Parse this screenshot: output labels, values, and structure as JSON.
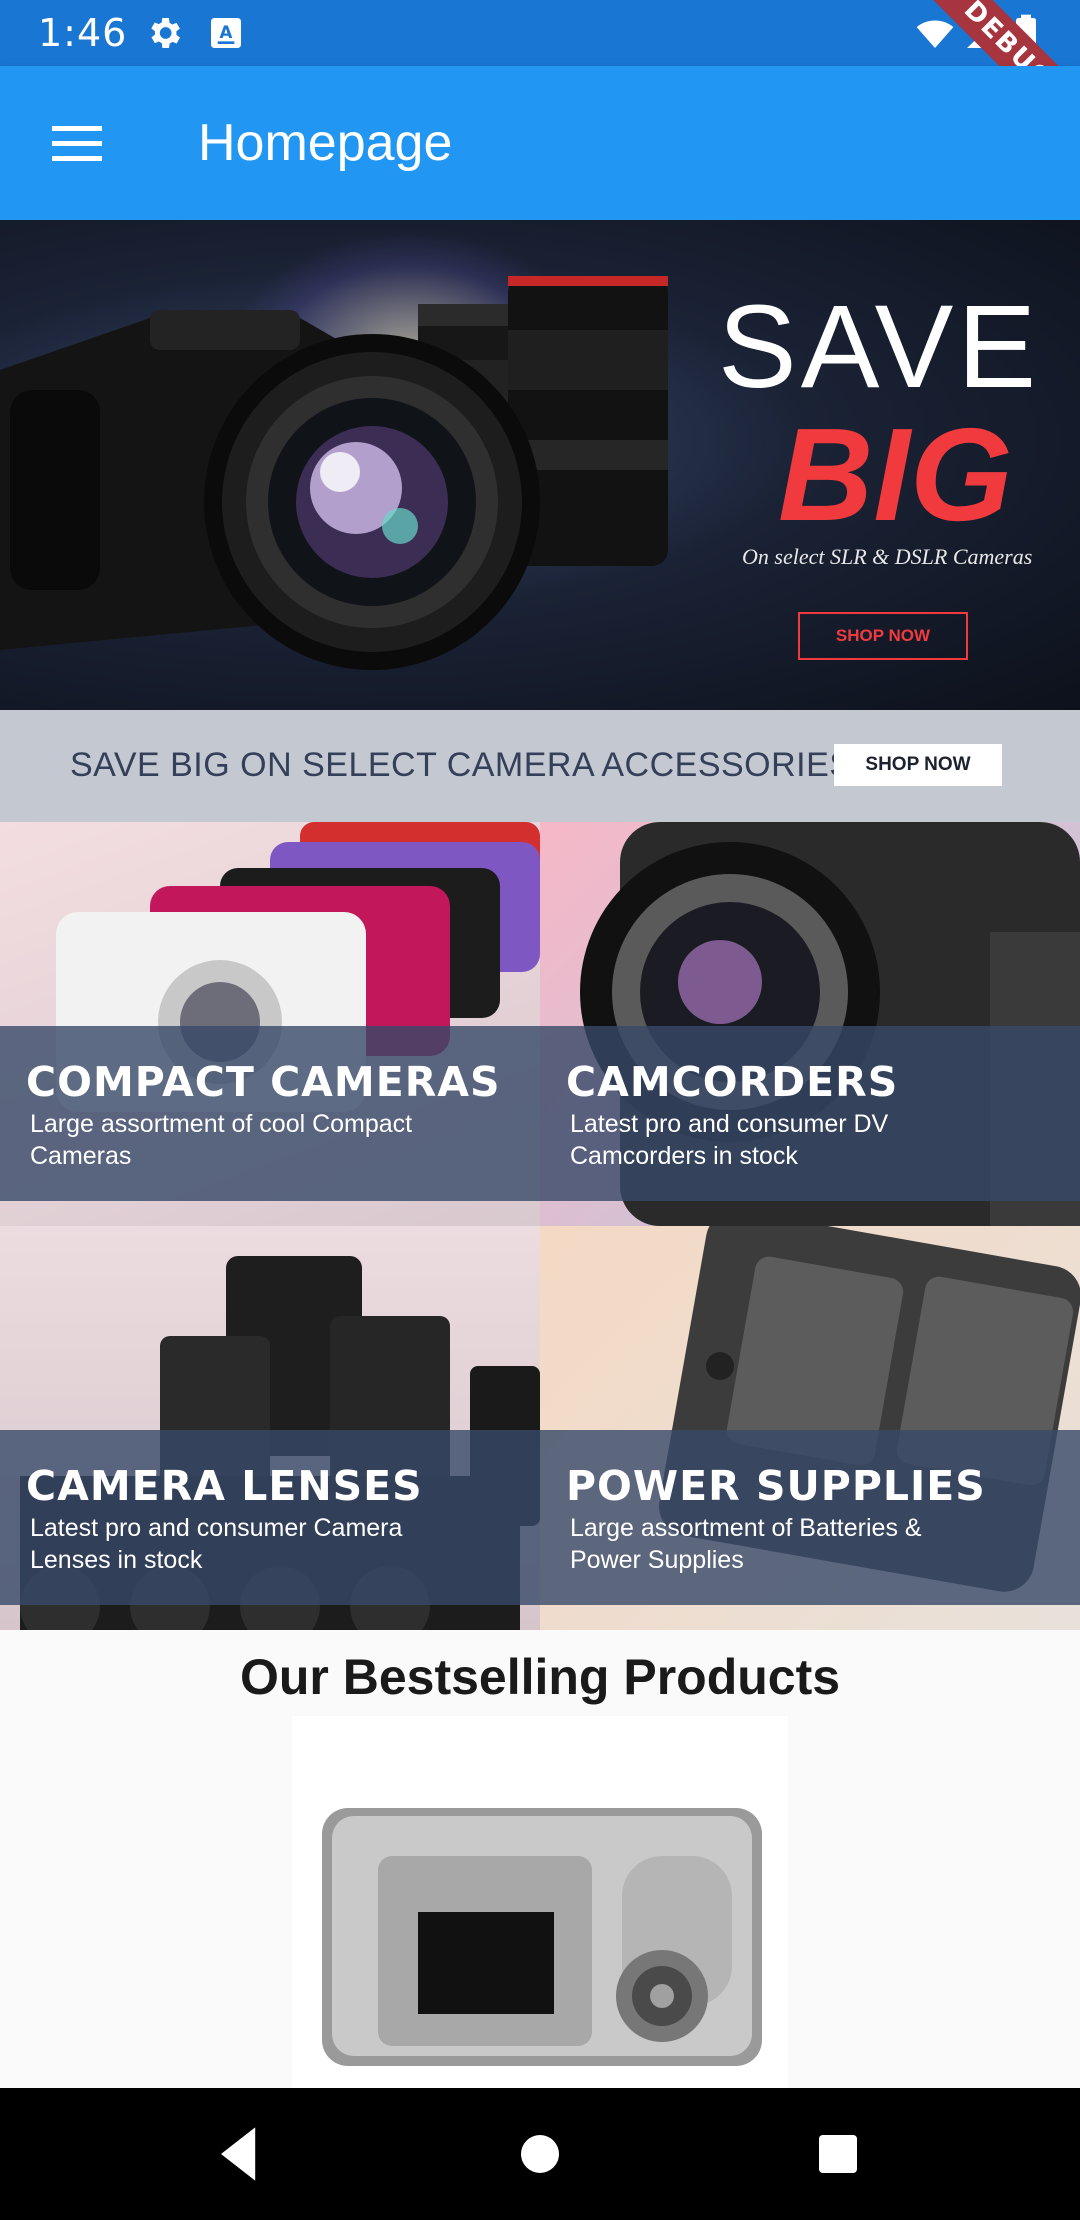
{
  "status_bar": {
    "time": "1:46",
    "icons": [
      "gear-icon",
      "keyboard-a-icon",
      "wifi-icon",
      "signal-icon",
      "battery-icon"
    ],
    "debug_label": "DEBUG"
  },
  "app_bar": {
    "title": "Homepage",
    "menu_icon": "hamburger-menu-icon",
    "color": "#2196f3"
  },
  "hero": {
    "headline_1": "SAVE",
    "headline_2": "BIG",
    "subtext": "On select SLR & DSLR Cameras",
    "button_label": "SHOP NOW",
    "accent_color": "#f03a3e"
  },
  "promo_strip": {
    "text": "SAVE BIG ON SELECT CAMERA ACCESSORIES",
    "button_label": "SHOP NOW"
  },
  "categories": [
    {
      "title": "COMPACT CAMERAS",
      "description": "Large assortment of cool Compact Cameras"
    },
    {
      "title": "CAMCORDERS",
      "description": "Latest pro and consumer DV Camcorders in stock"
    },
    {
      "title": "CAMERA LENSES",
      "description": "Latest pro and consumer Camera Lenses in stock"
    },
    {
      "title": "POWER SUPPLIES",
      "description": "Large assortment of Batteries & Power Supplies"
    }
  ],
  "bestselling": {
    "title": "Our Bestselling Products"
  },
  "nav_bar": {
    "icons": [
      "back-triangle-icon",
      "home-circle-icon",
      "recents-square-icon"
    ]
  }
}
